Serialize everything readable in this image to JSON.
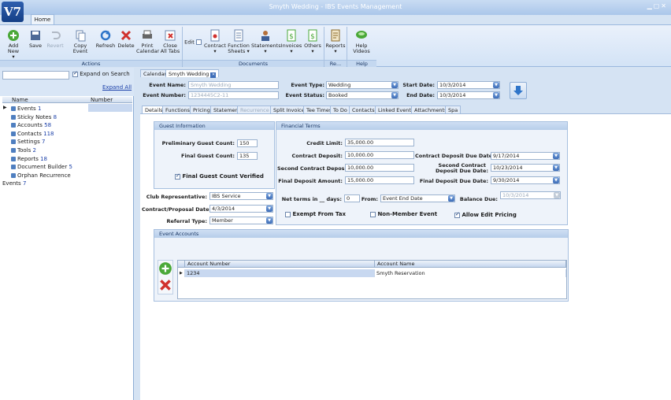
{
  "app": {
    "title": "Smyth Wedding - IBS Events Management",
    "logo_text": "V7",
    "home_tab": "Home"
  },
  "ribbon": {
    "buttons": {
      "add_new": "Add New",
      "save": "Save",
      "revert": "Revert",
      "copy_event": "Copy Event",
      "refresh": "Refresh",
      "delete": "Delete",
      "print_calendar_1": "Print",
      "print_calendar_2": "Calendar",
      "close_all_1": "Close",
      "close_all_2": "All Tabs",
      "edit": "Edit",
      "contract": "Contract",
      "function_1": "Function",
      "function_2": "Sheets",
      "statements": "Statements",
      "invoices": "Invoices",
      "others": "Others",
      "reports": "Reports",
      "help_videos": "Help Videos"
    },
    "groups": {
      "actions": "Actions",
      "documents": "Documents",
      "re": "Re...",
      "help": "Help"
    }
  },
  "left": {
    "expand_on_search": "Expand on Search",
    "expand_all": "Expand All",
    "col_name": "Name",
    "col_number": "Number",
    "items": [
      {
        "label": "Events",
        "count": "1"
      },
      {
        "label": "Sticky Notes",
        "count": "8"
      },
      {
        "label": "Accounts",
        "count": "58"
      },
      {
        "label": "Contacts",
        "count": "118"
      },
      {
        "label": "Settings",
        "count": "7"
      },
      {
        "label": "Tools",
        "count": "2"
      },
      {
        "label": "Reports",
        "count": "18"
      },
      {
        "label": "Document Builder",
        "count": "5"
      },
      {
        "label": "Orphan Recurrence Events",
        "count": "7"
      }
    ]
  },
  "doc_tabs": {
    "calendar": "Calendar",
    "smyth": "Smyth Wedding"
  },
  "header": {
    "event_name_label": "Event Name:",
    "event_name": "Smyth Wedding",
    "event_number_label": "Event Number:",
    "event_number": "1234445C2-11",
    "event_type_label": "Event Type:",
    "event_type": "Wedding",
    "event_status_label": "Event Status:",
    "event_status": "Booked",
    "start_date_label": "Start Date:",
    "start_date": "10/3/2014",
    "end_date_label": "End Date:",
    "end_date": "10/3/2014"
  },
  "subtabs": [
    "Details",
    "Functions",
    "Pricing",
    "Statement",
    "Recurrence",
    "Split Invoice",
    "Tee Times",
    "To Do",
    "Contacts",
    "Linked Events",
    "Attachments",
    "Spa"
  ],
  "guest": {
    "title": "Guest Information",
    "prelim_label": "Preliminary Guest Count:",
    "prelim": "150",
    "final_label": "Final Guest Count:",
    "final": "135",
    "verified_label": "Final Guest Count Verified"
  },
  "club": {
    "rep_label": "Club Representative:",
    "rep": "IBS Service",
    "date_label": "Contract/Proposal Date:",
    "date": "4/3/2014",
    "ref_label": "Referral Type:",
    "ref": "Member"
  },
  "financial": {
    "title": "Financial Terms",
    "credit_limit_label": "Credit Limit:",
    "credit_limit": "35,000.00",
    "contract_deposit_label": "Contract Deposit:",
    "contract_deposit": "10,000.00",
    "second_deposit_label": "Second Contract Deposit:",
    "second_deposit": "10,000.00",
    "final_deposit_label": "Final Deposit Amount:",
    "final_deposit": "15,000.00",
    "cd_due_label": "Contract Deposit Due Date:",
    "cd_due": "9/17/2014",
    "scd_due_label_1": "Second Contract",
    "scd_due_label_2": "Deposit Due Date:",
    "scd_due": "10/23/2014",
    "fd_due_label": "Final Deposit Due Date:",
    "fd_due": "9/30/2014",
    "net_terms_label": "Net terms in __ days:",
    "net_terms": "0",
    "from_label": "From:",
    "from": "Event End Date",
    "balance_due_label": "Balance Due:",
    "balance_due": "10/3/2014",
    "exempt_label": "Exempt From Tax",
    "nonmember_label": "Non-Member Event",
    "allow_edit_label": "Allow Edit Pricing"
  },
  "accounts": {
    "title": "Event Accounts",
    "col_number": "Account Number",
    "col_name": "Account Name",
    "rows": [
      {
        "number": "1234",
        "name": "Smyth Reservation"
      }
    ]
  }
}
